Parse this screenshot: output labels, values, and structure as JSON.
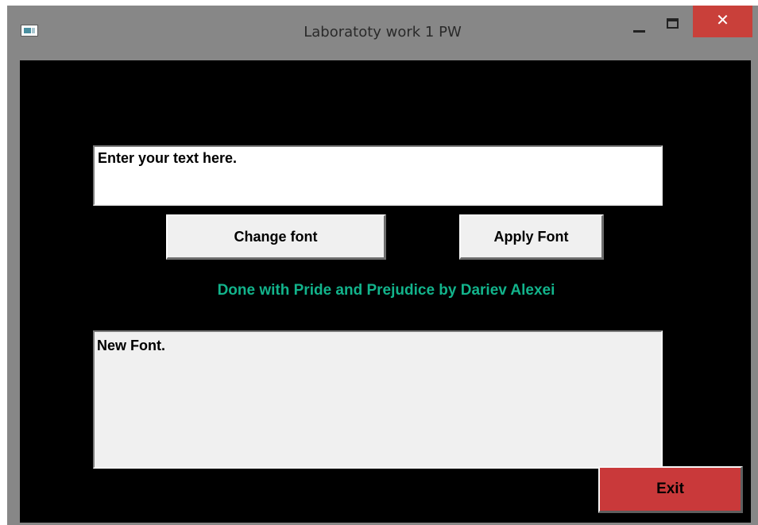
{
  "window": {
    "title": "Laboratoty work 1 PW",
    "close_glyph": "✕",
    "colors": {
      "frame": "#878787",
      "client_background": "#000000",
      "close_button": "#c9403a"
    }
  },
  "icons": {
    "app": "app-window-icon",
    "minimize": "minimize-icon",
    "maximize": "maximize-icon",
    "close": "close-icon"
  },
  "input": {
    "value": "Enter your text here."
  },
  "buttons": {
    "change_font": "Change font",
    "apply_font": "Apply Font",
    "exit": "Exit",
    "exit_color": "#c9393a"
  },
  "credit": {
    "text": "Done with Pride and Prejudice by Dariev Alexei",
    "color": "#12b38b"
  },
  "output": {
    "text": "New Font."
  }
}
